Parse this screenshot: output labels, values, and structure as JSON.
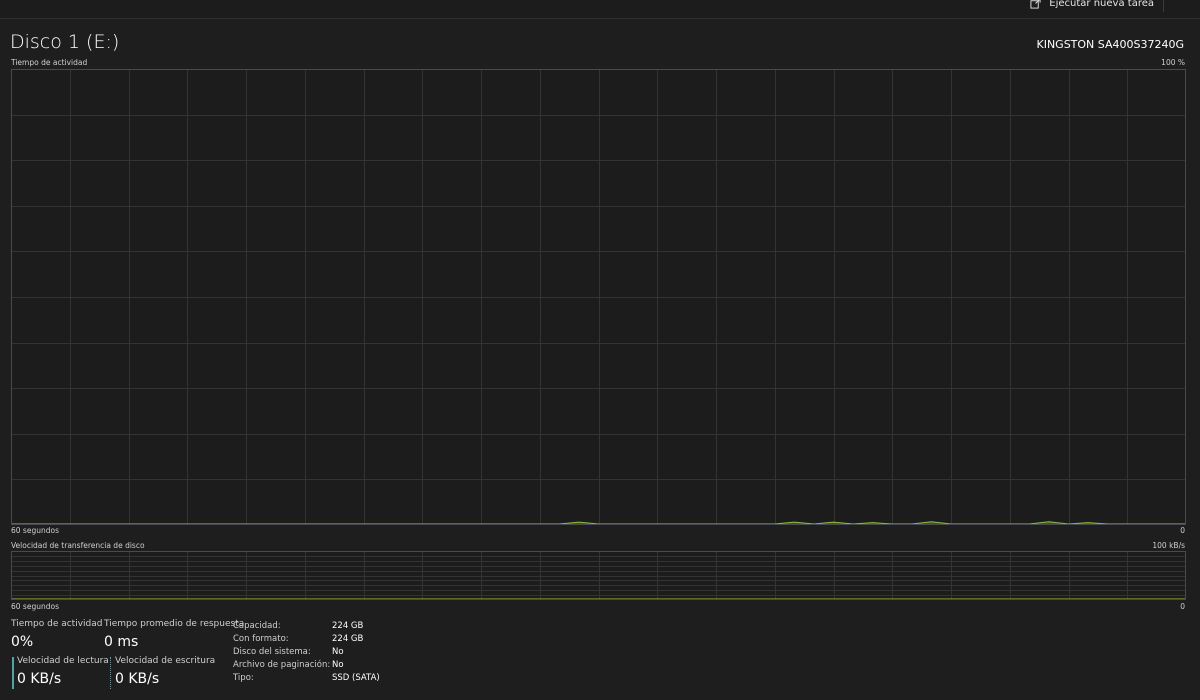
{
  "toolbar": {
    "run_new_task_label": "Ejecutar nueva tarea",
    "more_label": "···"
  },
  "header": {
    "title": "Disco 1 (E:)",
    "model": "KINGSTON SA400S37240G"
  },
  "activity_graph": {
    "label": "Tiempo de actividad",
    "max_label": "100 %",
    "time_label": "60 segundos",
    "min_label": "0",
    "line_color": "#8cbf3f",
    "grid_color": "#333333",
    "border_color": "#4a4a4a"
  },
  "transfer_graph": {
    "label": "Velocidad de transferencia de disco",
    "max_label": "100 kB/s",
    "time_label": "60 segundos",
    "min_label": "0"
  },
  "stats": {
    "activity": {
      "label": "Tiempo de actividad",
      "value": "0%"
    },
    "response": {
      "label": "Tiempo promedio de respuesta",
      "value": "0 ms"
    },
    "read": {
      "label": "Velocidad de lectura",
      "value": "0 KB/s"
    },
    "write": {
      "label": "Velocidad de escritura",
      "value": "0 KB/s"
    }
  },
  "properties": [
    {
      "key": "Capacidad:",
      "value": "224 GB"
    },
    {
      "key": "Con formato:",
      "value": "224 GB"
    },
    {
      "key": "Disco del sistema:",
      "value": "No"
    },
    {
      "key": "Archivo de paginación:",
      "value": "No"
    },
    {
      "key": "Tipo:",
      "value": "SSD (SATA)"
    }
  ],
  "chart_data": [
    {
      "type": "area",
      "title": "Tiempo de actividad",
      "xlabel": "60 segundos",
      "ylim": [
        0,
        100
      ],
      "xlim": [
        60,
        0
      ],
      "series": [
        {
          "values": [
            0,
            0,
            0,
            0,
            0,
            0,
            0,
            0,
            0,
            0,
            0,
            0,
            0,
            0,
            0,
            0,
            0,
            0,
            0,
            0,
            0,
            0,
            0,
            0,
            0,
            0,
            0,
            0,
            0,
            0.4,
            0,
            0,
            0,
            0,
            0,
            0,
            0,
            0,
            0,
            0,
            0.4,
            0,
            0.4,
            0,
            0.3,
            0,
            0,
            0.5,
            0,
            0,
            0,
            0,
            0,
            0.5,
            0,
            0.3,
            0,
            0,
            0,
            0,
            0
          ]
        }
      ]
    },
    {
      "type": "area",
      "title": "Velocidad de transferencia de disco",
      "xlabel": "60 segundos",
      "ylim": [
        0,
        100
      ],
      "xlim": [
        60,
        0
      ],
      "series": [
        {
          "values": [
            0,
            0,
            0,
            0,
            0,
            0,
            0,
            0,
            0,
            0,
            0,
            0,
            0,
            0,
            0,
            0,
            0,
            0,
            0,
            0,
            0,
            0,
            0,
            0,
            0,
            0,
            0,
            0,
            0,
            0,
            0,
            0,
            0,
            0,
            0,
            0,
            0,
            0,
            0,
            0,
            0,
            0,
            0,
            0,
            0,
            0,
            0,
            0,
            0,
            0,
            0,
            0,
            0,
            0,
            0,
            0,
            0,
            0,
            0,
            0,
            0
          ]
        }
      ]
    }
  ]
}
